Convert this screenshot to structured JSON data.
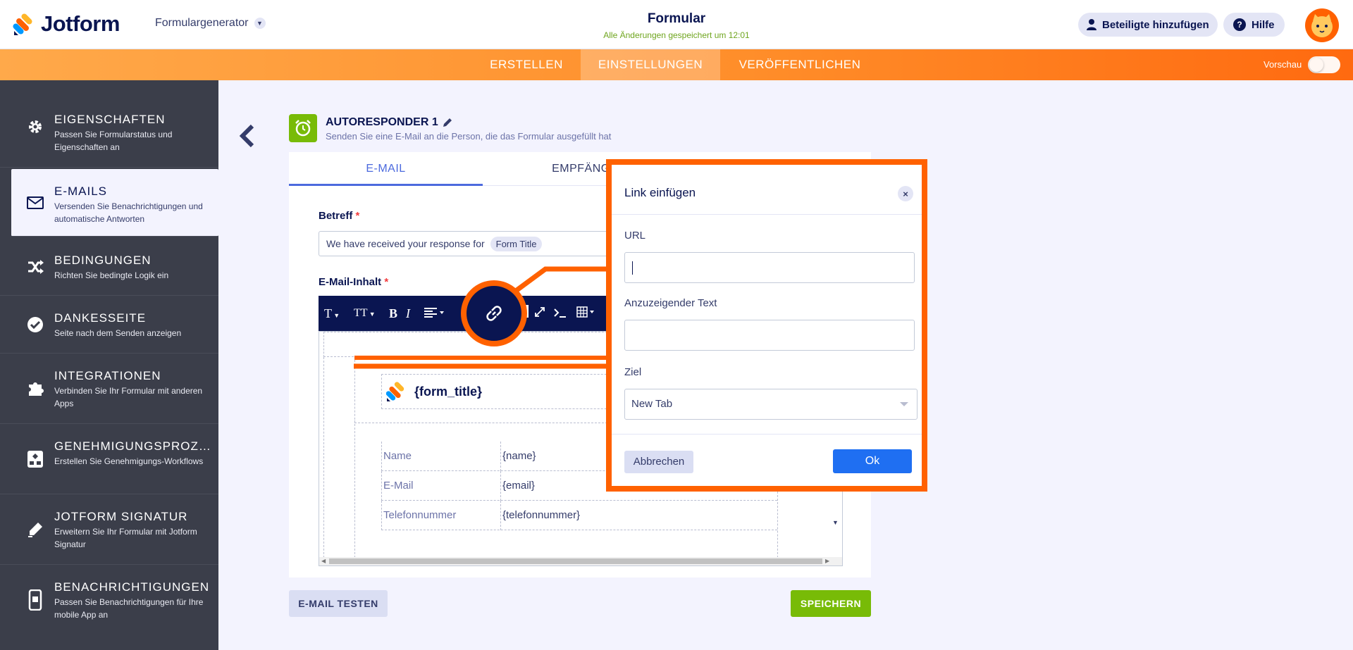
{
  "header": {
    "logo_text": "Jotform",
    "app_switch": "Formulargenerator",
    "form_title": "Formular",
    "saved_note": "Alle Änderungen gespeichert um 12:01",
    "collab_label": "Beteiligte hinzufügen",
    "help_label": "Hilfe"
  },
  "nav": {
    "tabs": [
      "ERSTELLEN",
      "EINSTELLUNGEN",
      "VERÖFFENTLICHEN"
    ],
    "active_tab": "EINSTELLUNGEN",
    "preview_label": "Vorschau",
    "preview_on": false
  },
  "sidebar": {
    "items": [
      {
        "title": "EIGENSCHAFTEN",
        "desc": "Passen Sie Formularstatus und Eigenschaften an",
        "icon": "gear-icon"
      },
      {
        "title": "E-MAILS",
        "desc": "Versenden Sie Benachrichtigungen und automatische Antworten",
        "icon": "envelope-icon"
      },
      {
        "title": "BEDINGUNGEN",
        "desc": "Richten Sie bedingte Logik ein",
        "icon": "shuffle-icon"
      },
      {
        "title": "DANKESSEITE",
        "desc": "Seite nach dem Senden anzeigen",
        "icon": "check-circle-icon"
      },
      {
        "title": "INTEGRATIONEN",
        "desc": "Verbinden Sie Ihr Formular mit anderen Apps",
        "icon": "puzzle-icon"
      },
      {
        "title": "GENEHMIGUNGSPROZES...",
        "desc": "Erstellen Sie Genehmigungs-Workflows",
        "icon": "workflow-icon"
      },
      {
        "title": "JOTFORM SIGNATUR",
        "desc": "Erweitern Sie Ihr Formular mit Jotform Signatur",
        "icon": "pen-icon"
      },
      {
        "title": "BENACHRICHTIGUNGEN",
        "desc": "Passen Sie Benachrichtigungen für Ihre mobile App an",
        "icon": "mobile-icon"
      }
    ],
    "active_index": 1
  },
  "autoresponder": {
    "title": "AUTORESPONDER 1",
    "subtitle": "Senden Sie eine E-Mail an die Person, die das Formular ausgefüllt hat"
  },
  "panel": {
    "tabs": [
      "E-MAIL",
      "EMPFÄNGE"
    ],
    "subject_label": "Betreff",
    "subject_text": "We have received your response for",
    "subject_chip": "Form Title",
    "body_label": "E-Mail-Inhalt",
    "email_header_title": "{form_title}",
    "rows": [
      {
        "label": "Name",
        "value": "{name}"
      },
      {
        "label": "E-Mail",
        "value": "{email}"
      },
      {
        "label": "Telefonnummer",
        "value": "{telefonnummer}"
      }
    ],
    "test_button": "E-MAIL TESTEN",
    "save_button": "SPEICHERN"
  },
  "toolbar": {
    "font": "T",
    "size": "TT",
    "bold": "B",
    "italic": "I"
  },
  "modal": {
    "title": "Link einfügen",
    "url_label": "URL",
    "url_value": "",
    "text_label": "Anzuzeigender Text",
    "text_value": "",
    "target_label": "Ziel",
    "target_value": "New Tab",
    "cancel": "Abbrechen",
    "ok": "Ok"
  },
  "colors": {
    "orange": "#ff6100",
    "navy": "#0a1551",
    "green": "#78bb07",
    "blue": "#1f6ff2"
  }
}
